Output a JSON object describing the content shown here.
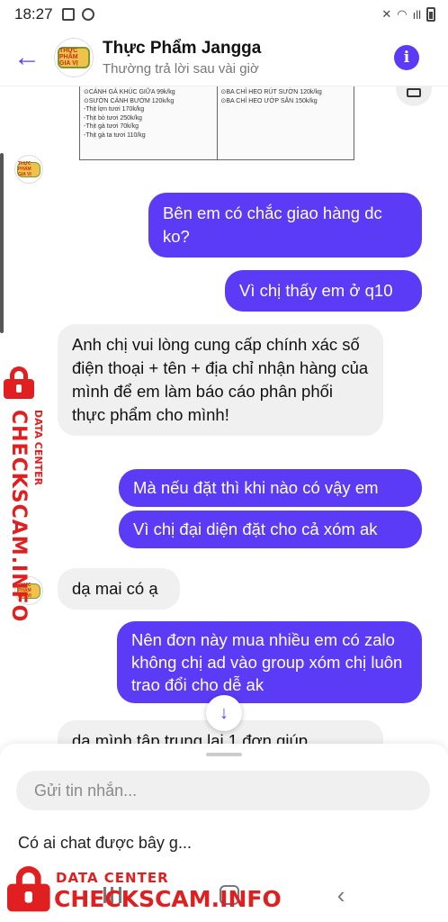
{
  "status_bar": {
    "time": "18:27",
    "signal_text": "ıll"
  },
  "header": {
    "back_glyph": "←",
    "title": "Thực Phẩm Jangga",
    "subtitle": "Thường trả lời sau vài giờ",
    "avatar_text": "THỰC PHẨM GIA VỊ",
    "info_glyph": "i"
  },
  "price_card": {
    "left_lines": [
      "⊙CÁNH GÀ KHÚC GIỮA 99k/kg",
      "⊙SƯỜN CÁNH BƯỚM 120k/kg",
      "-Thịt lợn tươi 170k/kg",
      "-Thịt bò tươi 250k/kg",
      "-Thịt gà tươi 70k/kg",
      "-Thịt gà ta tươi 110/kg"
    ],
    "right_lines": [
      "⊙BA CHỈ HEO RÚT SƯỜN 120k/kg",
      "⊙BA CHỈ HEO ƯỚP SẴN 150k/kg"
    ]
  },
  "messages": [
    {
      "sender": "me",
      "text": "Bên em có chắc giao hàng dc ko?"
    },
    {
      "sender": "me",
      "text": "Vì chị thấy em ở q10"
    },
    {
      "sender": "page",
      "text": "Anh chị vui lòng cung cấp chính xác số điện thoại + tên + địa chỉ nhận hàng của mình để em làm báo cáo phân phối thực phẩm cho mình!"
    },
    {
      "sender": "me",
      "text": "Mà nếu đặt thì khi nào có vậy em"
    },
    {
      "sender": "me",
      "text": "Vì chị đại diện đặt cho cả xóm ak"
    },
    {
      "sender": "page",
      "text": "dạ mai có ạ"
    },
    {
      "sender": "me",
      "text": "Nên đơn này mua nhiều em có zalo không chị ad vào group xóm chị luôn trao đổi cho dễ ak"
    },
    {
      "sender": "page",
      "text": "dạ mình tập trung lại 1 đơn giúp"
    }
  ],
  "scroll_down_glyph": "↓",
  "composer": {
    "placeholder": "Gửi tin nhắn...",
    "suggestion": "Có ai chat được bây g..."
  },
  "nav": {
    "back_glyph": "‹"
  },
  "watermark": {
    "small": "DATA CENTER",
    "big": "CHECKSCAM.INFO"
  },
  "colors": {
    "accent": "#5b3bf5",
    "received_bubble": "#f0f0f0",
    "watermark": "#e02020"
  }
}
